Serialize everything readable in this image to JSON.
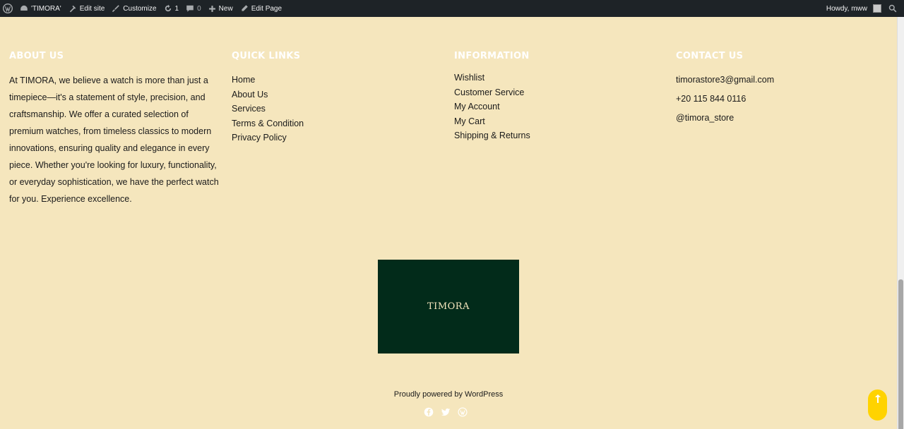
{
  "adminbar": {
    "site_name": "'TIMORA'",
    "edit_site": "Edit site",
    "customize": "Customize",
    "updates_count": "1",
    "comments_count": "0",
    "new": "New",
    "edit_page": "Edit Page",
    "howdy": "Howdy, mww"
  },
  "footer": {
    "about": {
      "title": "ABOUT US",
      "text": "At TIMORA, we believe a watch is more than just a timepiece—it's a statement of style, precision, and craftsmanship. We offer a curated selection of premium watches, from timeless classics to modern innovations, ensuring quality and elegance in every piece. Whether you're looking for luxury, functionality, or everyday sophistication, we have the perfect watch for you. Experience excellence."
    },
    "quick_links": {
      "title": "QUICK LINKS",
      "items": [
        "Home",
        "About Us",
        "Services",
        "Terms & Condition",
        "Privacy Policy"
      ]
    },
    "information": {
      "title": "INFORMATION",
      "items": [
        "Wishlist",
        "Customer Service",
        "My Account",
        "My Cart",
        "Shipping & Returns"
      ]
    },
    "contact": {
      "title": "CONTACT US",
      "items": [
        "timorastore3@gmail.com",
        "+20 115 844 0116",
        "@timora_store"
      ]
    },
    "logo_text": "TIMORA",
    "powered": "Proudly powered by WordPress"
  },
  "colors": {
    "background": "#f5e6bd",
    "adminbar": "#1e2327",
    "logo_bg": "#022b1a",
    "to_top": "#ffd300"
  }
}
